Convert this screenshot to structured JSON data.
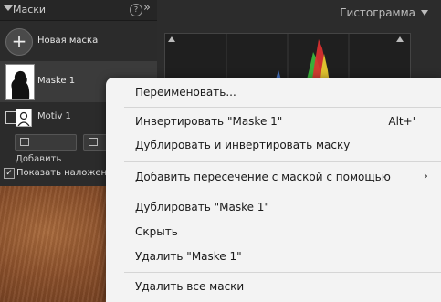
{
  "masks_panel": {
    "title": "Маски",
    "help_icon": "?",
    "collapse_icon": "»",
    "new_mask_label": "Новая маска",
    "mask_name": "Maske 1",
    "component_name": "Motiv 1",
    "add_button": "Добавить",
    "show_overlay_label": "Показать наложение",
    "show_overlay_checked": "✓"
  },
  "histogram": {
    "title": "Гистограмма"
  },
  "context_menu": {
    "items": [
      {
        "label": "Переименовать..."
      },
      {
        "label": "Инвертировать \"Maske 1\"",
        "shortcut": "Alt+'"
      },
      {
        "label": "Дублировать и инвертировать маску"
      },
      {
        "label": "Добавить пересечение с маской с помощью",
        "submenu": "›"
      },
      {
        "label": "Дублировать \"Maske 1\""
      },
      {
        "label": "Скрыть"
      },
      {
        "label": "Удалить \"Maske 1\""
      },
      {
        "label": "Удалить все маски"
      }
    ]
  },
  "colors": {
    "menu_bg": "#f3f3f3",
    "panel_bg": "#2b2b2b",
    "selected_row": "#3b3b3b"
  }
}
